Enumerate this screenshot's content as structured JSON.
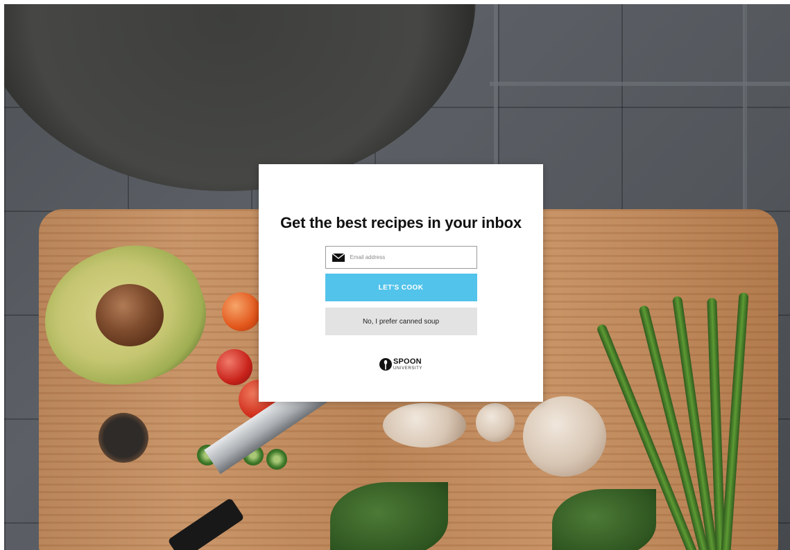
{
  "background": {
    "image_icon": "food-prep-photo"
  },
  "modal": {
    "title": "Get the best recipes in your inbox",
    "email": {
      "value": "",
      "placeholder": "Email address",
      "icon": "envelope-icon"
    },
    "primary_button": "LET'S COOK",
    "secondary_button": "No, I prefer canned soup",
    "logo": {
      "word": "SPOON",
      "sub": "UNIVERSITY",
      "icon": "spoon-logo-icon"
    }
  },
  "colors": {
    "accent": "#52c3ea",
    "secondary_button_bg": "#e3e3e3",
    "modal_bg": "#ffffff"
  }
}
